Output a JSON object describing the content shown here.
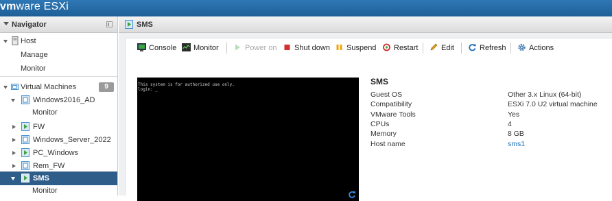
{
  "app": {
    "brand_vm": "vm",
    "brand_ware": "ware",
    "brand_esxi": " ESXi"
  },
  "navigator": {
    "title": "Navigator",
    "host": {
      "label": "Host",
      "children": [
        "Manage",
        "Monitor"
      ]
    },
    "vms_section": {
      "label": "Virtual Machines",
      "count": "9"
    },
    "vms": [
      {
        "label": "Windows2016_AD",
        "expanded": true,
        "children": [
          "Monitor"
        ]
      },
      {
        "label": "FW",
        "expanded": false
      },
      {
        "label": "Windows_Server_2022",
        "expanded": false
      },
      {
        "label": "PC_Windows",
        "expanded": false
      },
      {
        "label": "Rem_FW",
        "expanded": false
      },
      {
        "label": "SMS",
        "expanded": true,
        "selected": true,
        "children": [
          "Monitor"
        ]
      }
    ]
  },
  "main": {
    "title": "SMS",
    "toolbar": {
      "console": "Console",
      "monitor": "Monitor",
      "power_on": "Power on",
      "shut_down": "Shut down",
      "suspend": "Suspend",
      "restart": "Restart",
      "edit": "Edit",
      "refresh": "Refresh",
      "actions": "Actions"
    },
    "console_text": {
      "line1": "This system is for authorized use only.",
      "line2": "login: _"
    },
    "vm": {
      "name": "SMS",
      "props": [
        {
          "label": "Guest OS",
          "value": "Other 3.x Linux (64-bit)"
        },
        {
          "label": "Compatibility",
          "value": "ESXi 7.0 U2 virtual machine"
        },
        {
          "label": "VMware Tools",
          "value": "Yes"
        },
        {
          "label": "CPUs",
          "value": "4"
        },
        {
          "label": "Memory",
          "value": "8 GB"
        },
        {
          "label": "Host name",
          "value": "sms1"
        }
      ]
    }
  },
  "colors": {
    "topbar": "#2f78b5",
    "selected_row": "#2f5d8a",
    "link": "#1f6fb5",
    "vm_icon_green": "#3aa53a",
    "vm_icon_blue": "#4a93cf"
  }
}
